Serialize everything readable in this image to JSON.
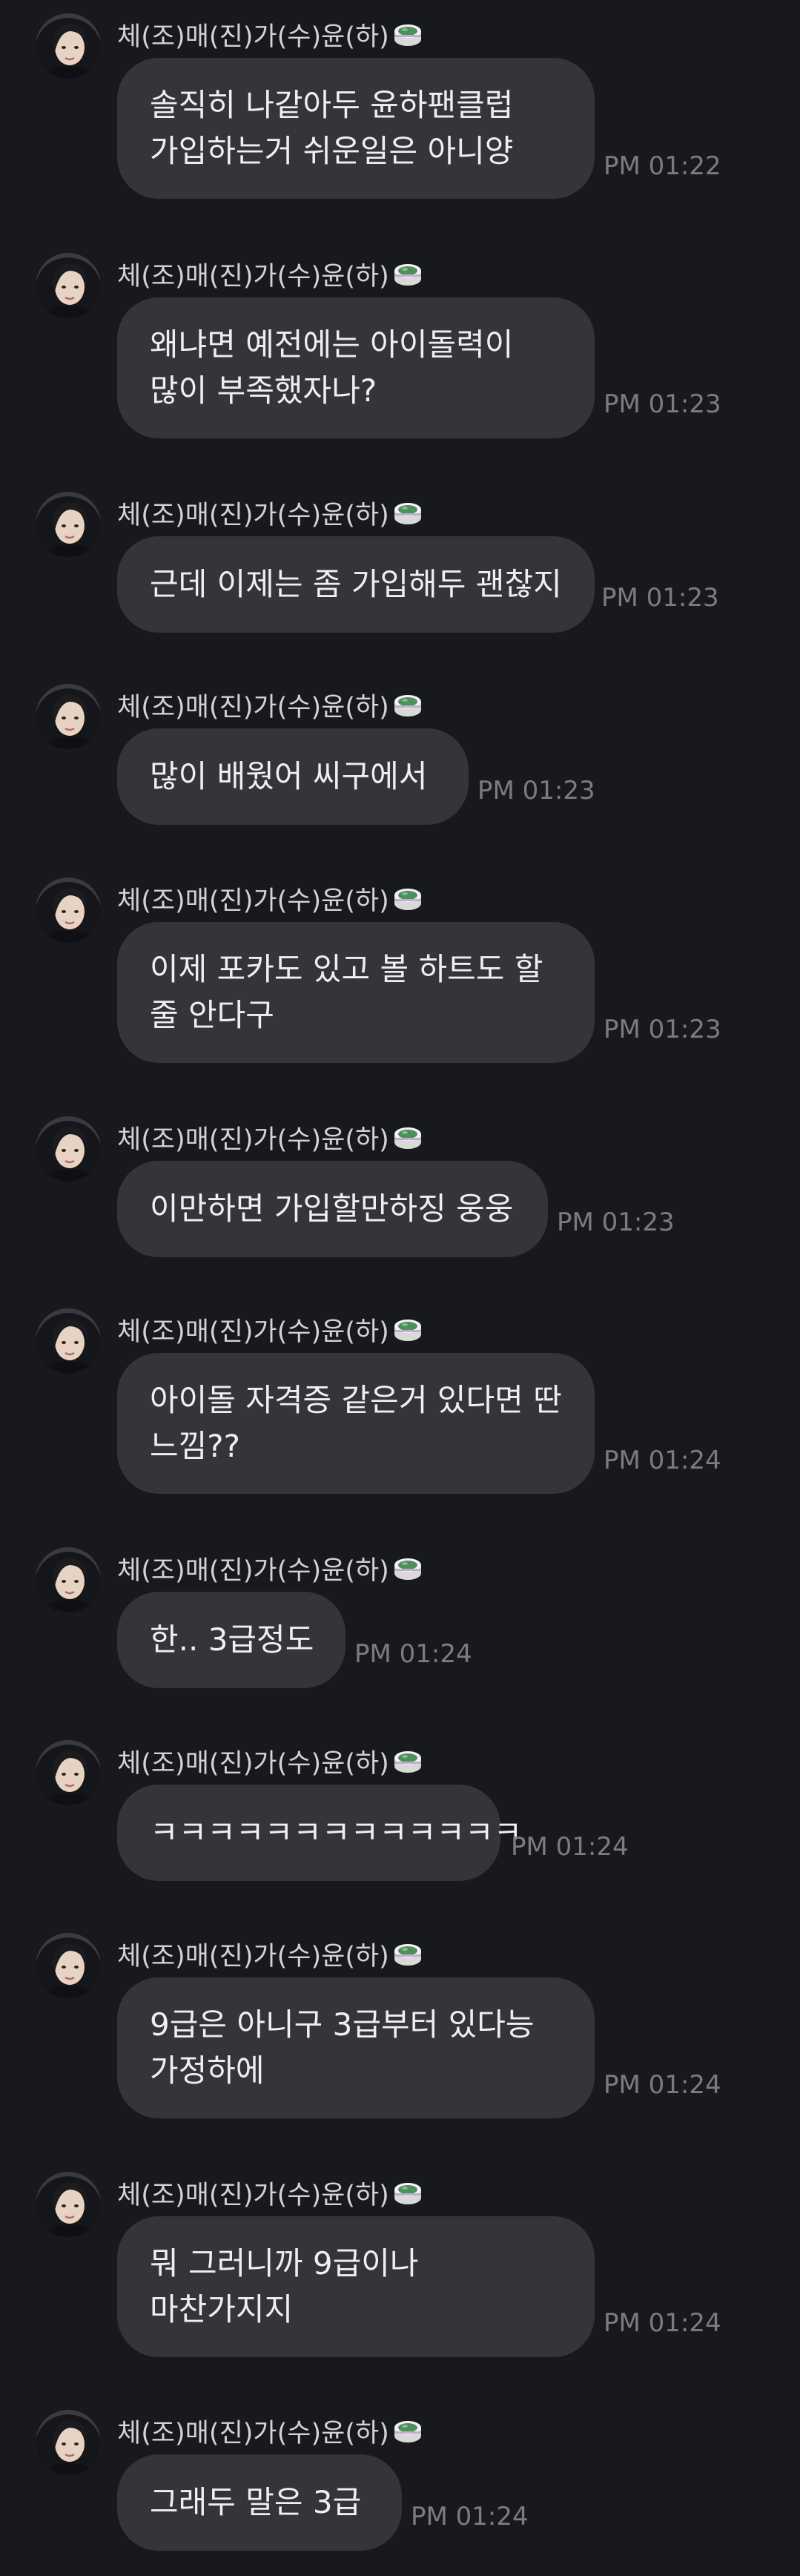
{
  "chat": {
    "sender_name": "체(조)매(진)가(수)윤(하)",
    "sender_emoji_icon": "tteok-cake-emoji-icon",
    "messages": [
      {
        "lines": [
          "솔직히 나같아두 윤하팬클럽",
          "가입하는거 쉬운일은 아니양"
        ],
        "time": "PM 01:22"
      },
      {
        "lines": [
          "왜냐면 예전에는 아이돌력이",
          "많이 부족했자나?"
        ],
        "time": "PM 01:23"
      },
      {
        "lines": [
          "근데 이제는 좀 가입해두 괜찮지"
        ],
        "time": "PM 01:23"
      },
      {
        "lines": [
          "많이 배웠어 씨구에서"
        ],
        "time": "PM 01:23"
      },
      {
        "lines": [
          "이제 포카도 있고 볼 하트도 할",
          "줄 안다구"
        ],
        "time": "PM 01:23"
      },
      {
        "lines": [
          "이만하면 가입할만하징 웅웅"
        ],
        "time": "PM 01:23"
      },
      {
        "lines": [
          "아이돌 자격증 같은거 있다면 딴",
          "느낌??"
        ],
        "time": "PM 01:24"
      },
      {
        "lines": [
          "한.. 3급정도"
        ],
        "time": "PM 01:24"
      },
      {
        "lines": [
          "ㅋㅋㅋㅋㅋㅋㅋㅋㅋㅋㅋㅋㅋ"
        ],
        "time": "PM 01:24"
      },
      {
        "lines": [
          "9급은 아니구 3급부터 있다능",
          "가정하에"
        ],
        "time": "PM 01:24"
      },
      {
        "lines": [
          "뭐 그러니까 9급이나",
          "마찬가지지"
        ],
        "time": "PM 01:24"
      },
      {
        "lines": [
          "그래두 말은 3급"
        ],
        "time": "PM 01:24"
      }
    ]
  },
  "colors": {
    "background": "#18191d",
    "bubble": "#34353b",
    "bubble_text": "#eeeff1",
    "name_text": "#d2d3d6",
    "time_text": "#7b7c81"
  }
}
